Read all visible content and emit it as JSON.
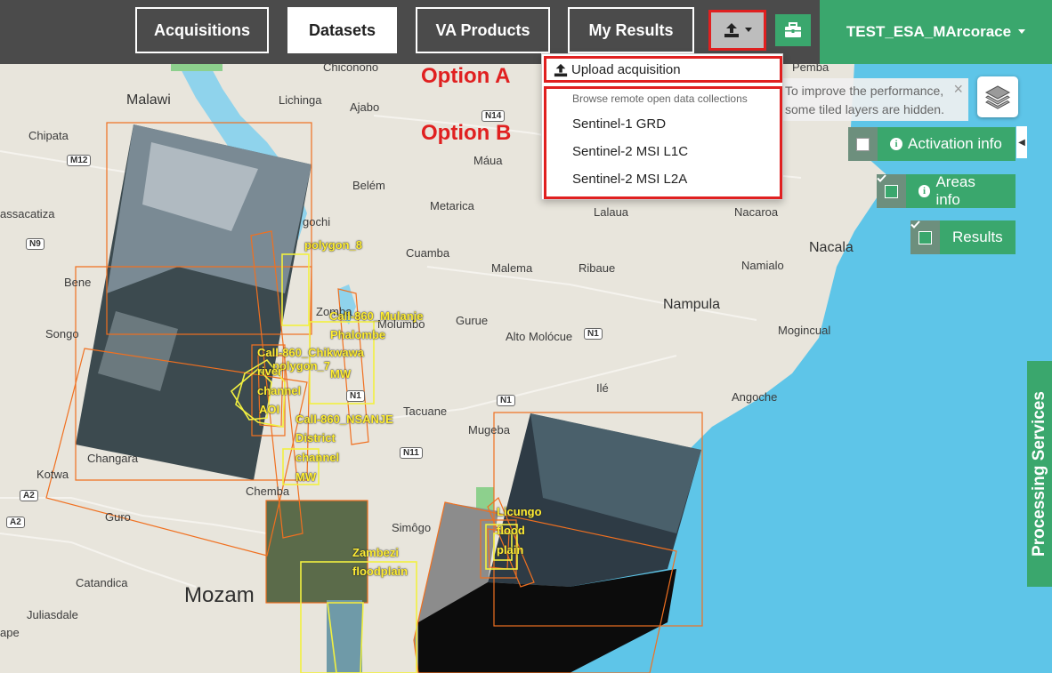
{
  "nav": {
    "acquisitions": "Acquisitions",
    "datasets": "Datasets",
    "va_products": "VA Products",
    "my_results": "My Results",
    "user": "TEST_ESA_MArcorace"
  },
  "annotations": {
    "option_a": "Option A",
    "option_b": "Option B"
  },
  "dropdown": {
    "upload": "Upload acquisition",
    "remote_header": "Browse remote open data collections",
    "items": [
      "Sentinel-1 GRD",
      "Sentinel-2 MSI L1C",
      "Sentinel-2 MSI L2A"
    ]
  },
  "notice": {
    "line1": "To improve the performance,",
    "line2": "some tiled layers are hidden.",
    "close": "×"
  },
  "controls": {
    "activation": {
      "label": "Activation info",
      "checked": false
    },
    "areas": {
      "label": "Areas info",
      "checked": true
    },
    "results": {
      "label": "Results",
      "checked": true
    }
  },
  "processing_services": "Processing Services",
  "map": {
    "places": {
      "malawi": "Malawi",
      "lichinga": "Lichinga",
      "ajabo": "Ajabo",
      "chipata": "Chipata",
      "chiconono": "Chiconono",
      "pemba": "Pemba",
      "maua": "Máua",
      "belem": "Belém",
      "metarica": "Metarica",
      "lalaua": "Lalaua",
      "nacaroa": "Nacaroa",
      "assacatiza": "assacatiza",
      "gochi": "gochi",
      "cuamba": "Cuamba",
      "malema": "Malema",
      "ribaue": "Ribaue",
      "namialo": "Namialo",
      "nacala": "Nacala",
      "bene": "Bene",
      "zomba": "Zomba",
      "molumbo": "Molumbo",
      "nampula": "Nampula",
      "gurue": "Gurue",
      "songo": "Songo",
      "alto_molocue": "Alto Molócue",
      "mogincual": "Mogincual",
      "ile": "Ilé",
      "angoche": "Angoche",
      "tacuane": "Tacuane",
      "mugeba": "Mugeba",
      "changara": "Changara",
      "kotwa": "Kotwa",
      "chemba": "Chemba",
      "guro": "Guro",
      "simogo": "Simôgo",
      "catandica": "Catandica",
      "mozambique": "Mozam",
      "juliasdale": "Juliasdale",
      "ape": "ape"
    },
    "shields": {
      "m12": "M12",
      "n14": "N14",
      "n9": "N9",
      "n1a": "N1",
      "n1b": "N1",
      "n1c": "N1",
      "n11": "N11",
      "a2a": "A2",
      "a2b": "A2"
    },
    "aoi_labels": [
      "polygon_8",
      "Call-860_Mulanje",
      "Phalombe",
      "Call-860_Chikwawa",
      "polygon_7",
      "MW",
      "river",
      "channel",
      "AOI",
      "Call-860_NSANJE",
      "District",
      "channel",
      "MW",
      "Licungo",
      "flood",
      "plain",
      "Zambezi",
      "floodplain"
    ]
  },
  "colors": {
    "topbar": "#4b4b4b",
    "green": "#3aa76d",
    "highlight_red": "#e02020",
    "sea": "#5ec5e8",
    "footprint_orange": "#f07020",
    "aoi_yellow": "#f2f040"
  },
  "icons": {
    "upload": "upload-icon",
    "briefcase": "briefcase-icon",
    "caret": "caret-down-icon",
    "layers": "layers-icon",
    "info": "info-icon",
    "close": "close-icon"
  }
}
